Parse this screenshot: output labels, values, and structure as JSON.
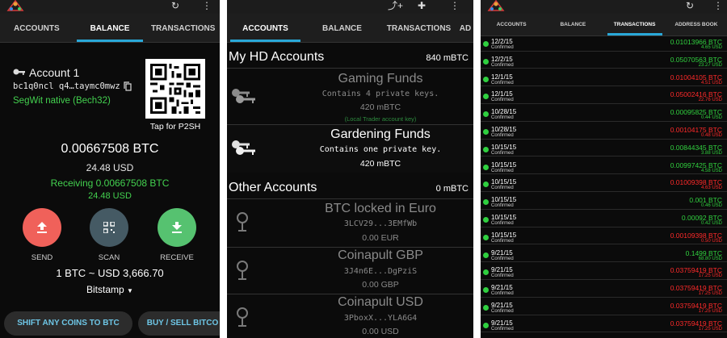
{
  "panel1": {
    "tabs": [
      {
        "label": "ACCOUNTS"
      },
      {
        "label": "BALANCE"
      },
      {
        "label": "TRANSACTIONS"
      }
    ],
    "account_title": "Account 1",
    "address": "bc1q0ncl q4…taymc0mwz",
    "address_type": "SegWit native (Bech32)",
    "qr_caption": "Tap for P2SH",
    "balance_btc": "0.00667508 BTC",
    "balance_usd": "24.48 USD",
    "receiving_btc": "Receiving 0.00667508 BTC",
    "receiving_usd": "24.48 USD",
    "actions": {
      "send": "SEND",
      "scan": "SCAN",
      "receive": "RECEIVE"
    },
    "rate": "1 BTC ~ USD 3,666.70",
    "exchange": "Bitstamp",
    "buttons": {
      "shift": "SHIFT ANY COINS TO BTC",
      "buy_sell": "BUY / SELL BITCO"
    },
    "colors": {
      "send": "#f0615a",
      "scan": "#455a64",
      "receive": "#56c270",
      "accent": "#29a8d8",
      "green": "#43d14f"
    }
  },
  "panel2": {
    "tabs": [
      {
        "label": "ACCOUNTS"
      },
      {
        "label": "BALANCE"
      },
      {
        "label": "TRANSACTIONS"
      },
      {
        "label": "AD"
      }
    ],
    "hd_section": {
      "title": "My HD Accounts",
      "total": "840 mBTC"
    },
    "hd_accounts": [
      {
        "name": "Gaming Funds",
        "desc": "Contains 4 private keys.",
        "amount": "420 mBTC",
        "note": "(Local Trader account key)"
      },
      {
        "name": "Gardening Funds",
        "desc": "Contains one private key.",
        "amount": "420 mBTC",
        "note": ""
      }
    ],
    "other_section": {
      "title": "Other Accounts",
      "total": "0 mBTC"
    },
    "other_accounts": [
      {
        "name": "BTC locked in Euro",
        "desc": "3LCV29...3EMfWb",
        "amount": "0.00 EUR"
      },
      {
        "name": "Coinapult GBP",
        "desc": "3J4n6E...DgPziS",
        "amount": "0.00 GBP"
      },
      {
        "name": "Coinapult USD",
        "desc": "3PboxX...YLA6G4",
        "amount": "0.00 USD"
      }
    ]
  },
  "panel3": {
    "tabs": [
      {
        "label": "ACCOUNTS"
      },
      {
        "label": "BALANCE"
      },
      {
        "label": "TRANSACTIONS"
      },
      {
        "label": "ADDRESS BOOK"
      }
    ],
    "transactions": [
      {
        "date": "12/2/15",
        "status": "Confirmed",
        "amount": "0.01013966 BTC",
        "usd": "4.65 USD",
        "dir": "in"
      },
      {
        "date": "12/2/15",
        "status": "Confirmed",
        "amount": "0.05070563 BTC",
        "usd": "23.27 USD",
        "dir": "in"
      },
      {
        "date": "12/1/15",
        "status": "Confirmed",
        "amount": "0.01004105 BTC",
        "usd": "4.51 USD",
        "dir": "out"
      },
      {
        "date": "12/1/15",
        "status": "Confirmed",
        "amount": "0.05002416 BTC",
        "usd": "22.76 USD",
        "dir": "out"
      },
      {
        "date": "10/28/15",
        "status": "Confirmed",
        "amount": "0.00095825 BTC",
        "usd": "0.44 USD",
        "dir": "in"
      },
      {
        "date": "10/28/15",
        "status": "Confirmed",
        "amount": "0.00104175 BTC",
        "usd": "0.48 USD",
        "dir": "out"
      },
      {
        "date": "10/15/15",
        "status": "Confirmed",
        "amount": "0.00844345 BTC",
        "usd": "3.88 USD",
        "dir": "in"
      },
      {
        "date": "10/15/15",
        "status": "Confirmed",
        "amount": "0.00997425 BTC",
        "usd": "4.58 USD",
        "dir": "in"
      },
      {
        "date": "10/15/15",
        "status": "Confirmed",
        "amount": "0.01009398 BTC",
        "usd": "4.63 USD",
        "dir": "out"
      },
      {
        "date": "10/15/15",
        "status": "Confirmed",
        "amount": "0.001 BTC",
        "usd": "0.46 USD",
        "dir": "in"
      },
      {
        "date": "10/15/15",
        "status": "Confirmed",
        "amount": "0.00092 BTC",
        "usd": "0.42 USD",
        "dir": "in"
      },
      {
        "date": "10/15/15",
        "status": "Confirmed",
        "amount": "0.00109398 BTC",
        "usd": "0.50 USD",
        "dir": "out"
      },
      {
        "date": "9/21/15",
        "status": "Confirmed",
        "amount": "0.1499 BTC",
        "usd": "68.80 USD",
        "dir": "in"
      },
      {
        "date": "9/21/15",
        "status": "Confirmed",
        "amount": "0.03759419 BTC",
        "usd": "17.25 USD",
        "dir": "out"
      },
      {
        "date": "9/21/15",
        "status": "Confirmed",
        "amount": "0.03759419 BTC",
        "usd": "17.25 USD",
        "dir": "out"
      },
      {
        "date": "9/21/15",
        "status": "Confirmed",
        "amount": "0.03759419 BTC",
        "usd": "17.25 USD",
        "dir": "out"
      },
      {
        "date": "9/21/15",
        "status": "Confirmed",
        "amount": "0.03759419 BTC",
        "usd": "17.25 USD",
        "dir": "out"
      }
    ],
    "colors": {
      "in": "#31d13f",
      "out": "#ff2a2a"
    }
  }
}
